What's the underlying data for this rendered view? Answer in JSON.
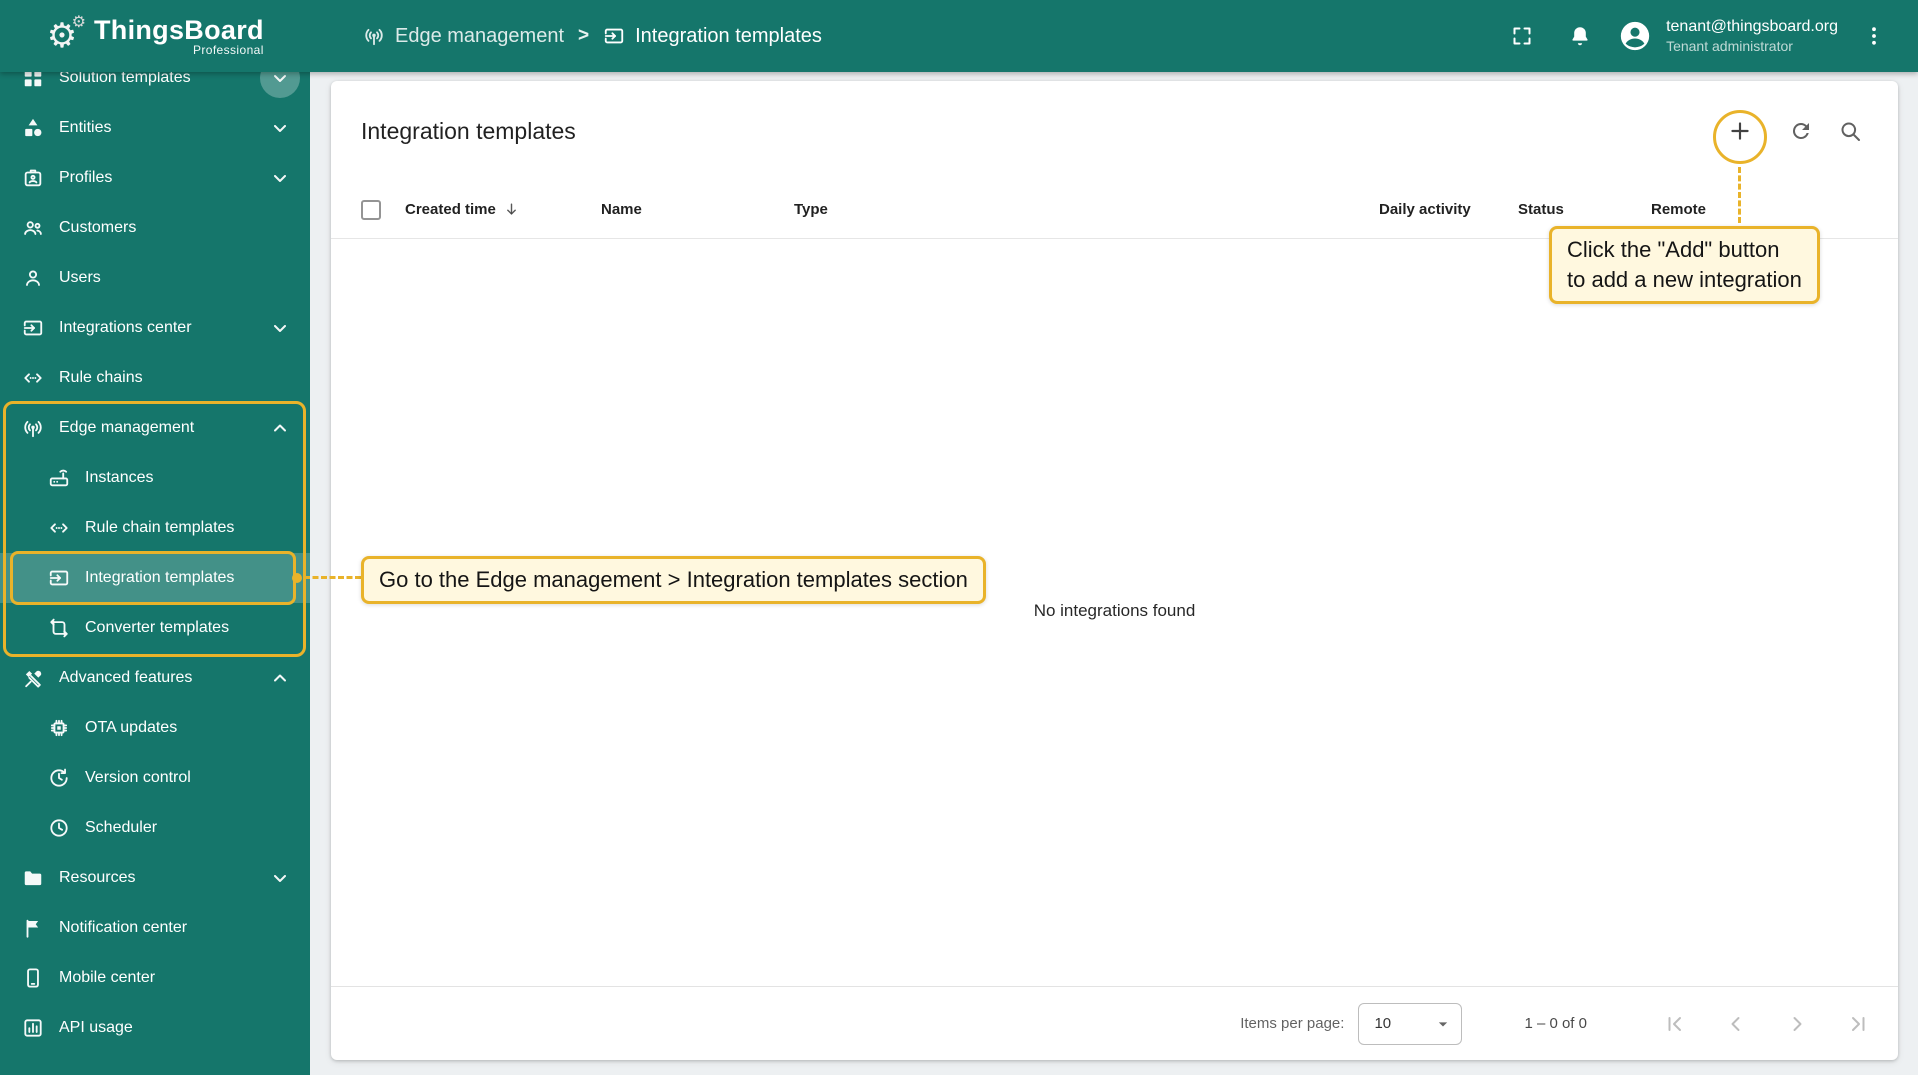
{
  "app": {
    "brand": "ThingsBoard",
    "brand_sub": "Professional",
    "breadcrumb": [
      {
        "label": "Edge management",
        "icon": "antenna-icon"
      },
      {
        "label": "Integration templates",
        "icon": "input-icon"
      }
    ],
    "breadcrumb_separator": ">",
    "user": {
      "email": "tenant@thingsboard.org",
      "role": "Tenant administrator"
    }
  },
  "theme": {
    "primary_green": "#15766B",
    "accent_gold": "#E9B32A",
    "callout_bg": "#FFF8DF"
  },
  "sidebar": {
    "items": [
      {
        "id": "solution-templates",
        "label": "Solution templates",
        "icon": "apps-grid-icon",
        "glyph": "apps",
        "chevron": "down",
        "cut": true
      },
      {
        "id": "entities",
        "label": "Entities",
        "icon": "entities-icon",
        "glyph": "category",
        "chevron": "down"
      },
      {
        "id": "profiles",
        "label": "Profiles",
        "icon": "profiles-badge-icon",
        "glyph": "badge",
        "chevron": "down"
      },
      {
        "id": "customers",
        "label": "Customers",
        "icon": "customers-people-icon",
        "glyph": "people"
      },
      {
        "id": "users",
        "label": "Users",
        "icon": "users-person-icon",
        "glyph": "person"
      },
      {
        "id": "integrations-center",
        "label": "Integrations center",
        "icon": "integrations-input-icon",
        "glyph": "input",
        "chevron": "down"
      },
      {
        "id": "rule-chains",
        "label": "Rule chains",
        "icon": "rule-chains-icon",
        "glyph": "ethernet"
      },
      {
        "id": "edge-management",
        "label": "Edge management",
        "icon": "edge-antenna-icon",
        "glyph": "antenna",
        "chevron": "up"
      },
      {
        "id": "instances",
        "label": "Instances",
        "icon": "instances-router-icon",
        "glyph": "router",
        "sub": true
      },
      {
        "id": "rule-chain-templates",
        "label": "Rule chain templates",
        "icon": "rule-chains-icon",
        "glyph": "ethernet",
        "sub": true
      },
      {
        "id": "integration-templates",
        "label": "Integration templates",
        "icon": "integrations-input-icon",
        "glyph": "input",
        "sub": true,
        "selected": true
      },
      {
        "id": "converter-templates",
        "label": "Converter templates",
        "icon": "converter-transform-icon",
        "glyph": "transform",
        "sub": true
      },
      {
        "id": "advanced-features",
        "label": "Advanced features",
        "icon": "advanced-tools-icon",
        "glyph": "tools",
        "chevron": "up"
      },
      {
        "id": "ota-updates",
        "label": "OTA updates",
        "icon": "ota-chip-icon",
        "glyph": "chip",
        "sub": true
      },
      {
        "id": "version-control",
        "label": "Version control",
        "icon": "version-history-icon",
        "glyph": "history",
        "sub": true
      },
      {
        "id": "scheduler",
        "label": "Scheduler",
        "icon": "scheduler-clock-icon",
        "glyph": "clock",
        "sub": true
      },
      {
        "id": "resources",
        "label": "Resources",
        "icon": "resources-folder-icon",
        "glyph": "folder",
        "chevron": "down"
      },
      {
        "id": "notification-center",
        "label": "Notification center",
        "icon": "notification-flag-icon",
        "glyph": "flag"
      },
      {
        "id": "mobile-center",
        "label": "Mobile center",
        "icon": "mobile-phone-icon",
        "glyph": "phone"
      },
      {
        "id": "api-usage",
        "label": "API usage",
        "icon": "api-chart-icon",
        "glyph": "chart"
      }
    ]
  },
  "main": {
    "title": "Integration templates",
    "table": {
      "columns": [
        "Created time",
        "Name",
        "Type",
        "Daily activity",
        "Status",
        "Remote"
      ],
      "empty_text": "No integrations found"
    },
    "pagination": {
      "items_per_page_label": "Items per page:",
      "items_per_page_value": "10",
      "range": "1 – 0 of 0"
    }
  },
  "callouts": {
    "add_button_lines": [
      "Click the \"Add\" button",
      "to add a new integration"
    ],
    "sidebar_nav": "Go to the Edge management > Integration templates section"
  }
}
